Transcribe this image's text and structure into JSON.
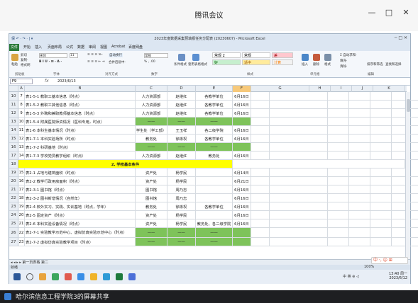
{
  "meeting_app": {
    "title": "腾讯会议",
    "controls": {
      "minimize": "—",
      "maximize": "□",
      "close": "✕"
    }
  },
  "excel": {
    "window_title": "2023年度数据采集预填报任务分配表 (20230607) - Microsoft Excel",
    "qat_text": "保 ↶ · ↷ · | ▾",
    "window_controls": "─  □  ✕",
    "tabs": {
      "file": "文件",
      "items": [
        "开始",
        "插入",
        "页面布局",
        "公式",
        "数据",
        "审阅",
        "视图",
        "Acrobat",
        "百度网盘"
      ]
    },
    "ribbon": {
      "clipboard": {
        "cut": "剪切",
        "copy": "复制·",
        "paste": "粘贴",
        "format_painter": "格式刷",
        "group": "剪贴板"
      },
      "font": {
        "name": "宋体",
        "size": "11",
        "group": "字体"
      },
      "alignment": {
        "wrap": "自动换行",
        "merge": "合并后居中·",
        "group": "对齐方式"
      },
      "number": {
        "format": "常规",
        "group": "数字",
        "symbols": "% , .00"
      },
      "styles": {
        "conditional": "条件格式",
        "table": "套用表格格式",
        "group": "样式",
        "cells": [
          {
            "label": "常规 2",
            "bg": "#ffffff"
          },
          {
            "label": "常规",
            "bg": "#ffffff"
          },
          {
            "label": "差",
            "bg": "#ffc7ce",
            "fg": "#9c0006"
          },
          {
            "label": "好",
            "bg": "#c6efce",
            "fg": "#006100"
          },
          {
            "label": "适中",
            "bg": "#ffeb9c",
            "fg": "#9c5700"
          },
          {
            "label": "计算",
            "bg": "#f2f2f2",
            "fg": "#fa7d00"
          }
        ]
      },
      "cells": {
        "insert": "插入",
        "delete": "删除",
        "format": "格式",
        "group": "单元格"
      },
      "editing": {
        "autosum": "Σ 自动求和·",
        "fill": "填充·",
        "clear": "清除·",
        "sort": "排序和筛选",
        "find": "查找和选择",
        "group": "编辑"
      }
    },
    "formula": {
      "namebox": "F9",
      "fx": "fx",
      "content": "2023/6/13"
    },
    "columns": [
      "A",
      "B",
      "C",
      "D",
      "E",
      "F",
      "G",
      "H",
      "I",
      "J",
      "K"
    ],
    "rows": [
      {
        "n": "10",
        "a": "7",
        "b": "表1-5-1  教职工基本信息（时点）",
        "c": "人力资源部",
        "d": "赵继红",
        "e": "各教学单位",
        "f": "6月16日"
      },
      {
        "n": "11",
        "a": "8",
        "b": "表1-5-2  教职工其他信息（时点）",
        "c": "人力资源部",
        "d": "赵继红",
        "e": "各教学单位",
        "f": "6月16日"
      },
      {
        "n": "12",
        "a": "9",
        "b": "表1-5-3  外聘和兼职教师基本信息（时点）",
        "c": "人力资源部",
        "d": "赵继红",
        "e": "各教学单位",
        "f": "6月16日"
      },
      {
        "n": "13",
        "a": "10",
        "b": "表1-5-4  附属医院师资情况（医科专用，时点）",
        "c": "——",
        "d": "——",
        "e": "——",
        "f": "",
        "green": true
      },
      {
        "n": "14",
        "a": "11",
        "b": "表1-6  本科生基本情况（时点）",
        "c": "学生处（学工部）",
        "d": "王玉祥",
        "e": "各二级学院",
        "f": "6月16日"
      },
      {
        "n": "15",
        "a": "12",
        "b": "表1-7-1  本科实验场所（时点）",
        "c": "教务处",
        "d": "徐彬权",
        "e": "各教学单位",
        "f": "6月16日"
      },
      {
        "n": "16",
        "a": "13",
        "b": "表1-7-2  科研基地（时点）",
        "c": "——",
        "d": "——",
        "e": "——",
        "f": "",
        "green": true
      },
      {
        "n": "17",
        "a": "14",
        "b": "表1-7-3  学校党员教学组织（时点）",
        "c": "人力资源部",
        "d": "赵继红",
        "e": "教务处",
        "f": "6月16日"
      },
      {
        "n": "18",
        "section": "2. 学校基本条件"
      },
      {
        "n": "19",
        "a": "15",
        "b": "表2-1  占地与建筑面积（时点）",
        "c": "资产处",
        "d": "杨学民",
        "e": "",
        "f": "6月14日"
      },
      {
        "n": "20",
        "a": "16",
        "b": "表2-2  教学行政用房面积（时点）",
        "c": "资产处",
        "d": "杨学民",
        "e": "",
        "f": "6月21日"
      },
      {
        "n": "21",
        "a": "17",
        "b": "表2-3-1  图书馆（时点）",
        "c": "图书馆",
        "d": "周乃志",
        "e": "",
        "f": "6月16日"
      },
      {
        "n": "22",
        "a": "18",
        "b": "表2-3-2  图书新增情况（自然年）",
        "c": "图书馆",
        "d": "周乃志",
        "e": "",
        "f": "6月16日"
      },
      {
        "n": "23",
        "a": "19",
        "b": "表2-4  校外实习、实践、实训基地（时点，学年）",
        "c": "教务处",
        "d": "徐彬权",
        "e": "各教学单位",
        "f": "6月16日"
      },
      {
        "n": "24",
        "a": "20",
        "b": "表2-5  固定资产（时点）",
        "c": "资产处",
        "d": "杨学民",
        "e": "",
        "f": "6月16日"
      },
      {
        "n": "25",
        "a": "21",
        "b": "表2-6  本科实验设备情况（时点）",
        "c": "资产处",
        "d": "杨学民",
        "e": "教务处、各二级学院",
        "f": "6月16日"
      },
      {
        "n": "26",
        "a": "22",
        "b": "表2-7-1  实验教学示范中心、虚拟仿真实验示范中心（时点）",
        "c": "——",
        "d": "——",
        "e": "——",
        "f": "",
        "green": true
      },
      {
        "n": "27",
        "a": "23",
        "b": "表2-7-2  虚拟仿真实验教学项目（时点）",
        "c": "——",
        "d": "——",
        "e": "——",
        "f": "",
        "green": true
      }
    ],
    "sheet_tabs": "◂ ◂ ▸ ▸  第一页表格  第二",
    "status": {
      "left": "就绪",
      "zoom": "100%"
    },
    "ime": "中 ·, ☺ ⊞",
    "taskbar": {
      "time": "13:40 周一",
      "date": "2023/6/12",
      "tray": "中 英 ⊕ ◁"
    }
  },
  "bottom": {
    "text": "哈尔滨信息工程学院3的屏幕共享"
  }
}
